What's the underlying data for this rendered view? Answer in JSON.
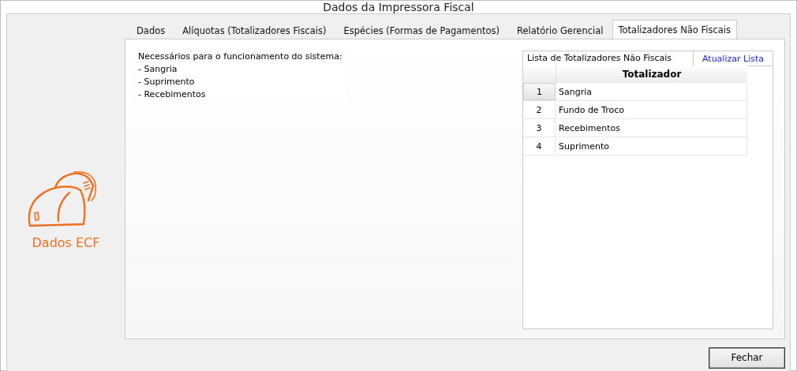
{
  "window": {
    "title": "Dados da Impressora Fiscal"
  },
  "sidebar": {
    "label": "Dados ECF"
  },
  "tabs": [
    {
      "label": "Dados",
      "selected": false
    },
    {
      "label": "Alíquotas (Totalizadores Fiscais)",
      "selected": false
    },
    {
      "label": "Espécies (Formas de Pagamentos)",
      "selected": false
    },
    {
      "label": "Relatório Gerencial",
      "selected": false
    },
    {
      "label": "Totalizadores Não Fiscais",
      "selected": true
    }
  ],
  "note": {
    "lines": [
      "Necessários para o funcionamento do sistema:",
      "- Sangria",
      "- Suprimento",
      "- Recebimentos"
    ]
  },
  "list_panel": {
    "title": "Lista de Totalizadores Não Fiscais",
    "refresh_button": "Atualizar Lista",
    "table": {
      "columns": [
        "Totalizador"
      ],
      "rows": [
        {
          "index": "1",
          "name": "Sangria",
          "selected": true
        },
        {
          "index": "2",
          "name": "Fundo de Troco",
          "selected": false
        },
        {
          "index": "3",
          "name": "Recebimentos",
          "selected": false
        },
        {
          "index": "4",
          "name": "Suprimento",
          "selected": false
        }
      ]
    }
  },
  "buttons": [
    {
      "label": "Fechar"
    }
  ]
}
